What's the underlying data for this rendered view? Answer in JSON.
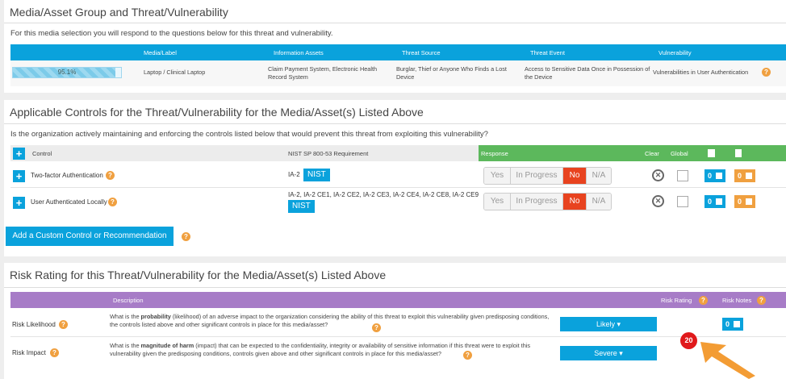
{
  "media_panel": {
    "title": "Media/Asset Group and Threat/Vulnerability",
    "subtitle": "For this media selection you will respond to the questions below for this threat and vulnerability.",
    "headers": [
      "Media/Label",
      "Information Assets",
      "Threat Source",
      "Threat Event",
      "Vulnerability"
    ],
    "progress_label": "95.1%",
    "progress_value": 0.951,
    "row": {
      "media": "Laptop / Clinical Laptop",
      "assets": "Claim Payment System, Electronic Health Record System",
      "threat_source": "Burglar, Thief or Anyone Who Finds a Lost Device",
      "threat_event": "Access to Sensitive Data Once in Possession of the Device",
      "vulnerability": "Vulnerabilities in User Authentication"
    }
  },
  "controls_panel": {
    "title": "Applicable Controls for the Threat/Vulnerability for the Media/Asset(s) Listed Above",
    "question": "Is the organization actively maintaining and enforcing the controls listed below that would prevent this threat from exploiting this vulnerability?",
    "headers": {
      "control": "Control",
      "nist": "NIST SP 800-53 Requirement",
      "response": "Response",
      "clear": "Clear",
      "global": "Global"
    },
    "response_options": [
      "Yes",
      "In Progress",
      "No",
      "N/A"
    ],
    "rows": [
      {
        "control": "Two-factor Authentication",
        "requirements": "IA-2",
        "nist_label": "NIST",
        "selected": "No",
        "notes_count": "0",
        "docs_count": "0"
      },
      {
        "control": "User Authenticated Locally",
        "requirements": "IA-2, IA-2 CE1, IA-2 CE2, IA-2 CE3, IA-2 CE4, IA-2 CE8, IA-2 CE9",
        "nist_label": "NIST",
        "selected": "No",
        "notes_count": "0",
        "docs_count": "0"
      }
    ],
    "add_button": "Add a Custom Control or Recommendation"
  },
  "risk_panel": {
    "title": "Risk Rating for this Threat/Vulnerability for the Media/Asset(s) Listed Above",
    "headers": {
      "description": "Description",
      "risk_rating": "Risk Rating",
      "risk_notes": "Risk Notes"
    },
    "likelihood": {
      "label": "Risk Likelihood",
      "desc_pre": "What is the ",
      "desc_bold": "probability",
      "desc_post": " (likelihood) of an adverse impact to the organization considering the ability of this threat to exploit this vulnerability given predisposing conditions, the controls listed above and other significant controls in place for this media/asset?",
      "value": "Likely ▾",
      "notes_count": "0"
    },
    "impact": {
      "label": "Risk Impact",
      "desc_pre": "What is the ",
      "desc_bold": "magnitude of harm",
      "desc_post": " (impact) that can be expected to the confidentiality, integrity or availability of sensitive information if this threat were to exploit this vulnerability given the predisposing conditions, controls given above and other significant controls in place for this media/asset?",
      "value": "Severe ▾"
    },
    "risk_rating_value": "20"
  },
  "colors": {
    "blue": "#0aa2dc",
    "green": "#5cb85c",
    "purple": "#a77cc7",
    "orange": "#f0a040",
    "red_selected": "#e8431f",
    "rating_red": "#e0191b",
    "arrow": "#f39c34"
  }
}
